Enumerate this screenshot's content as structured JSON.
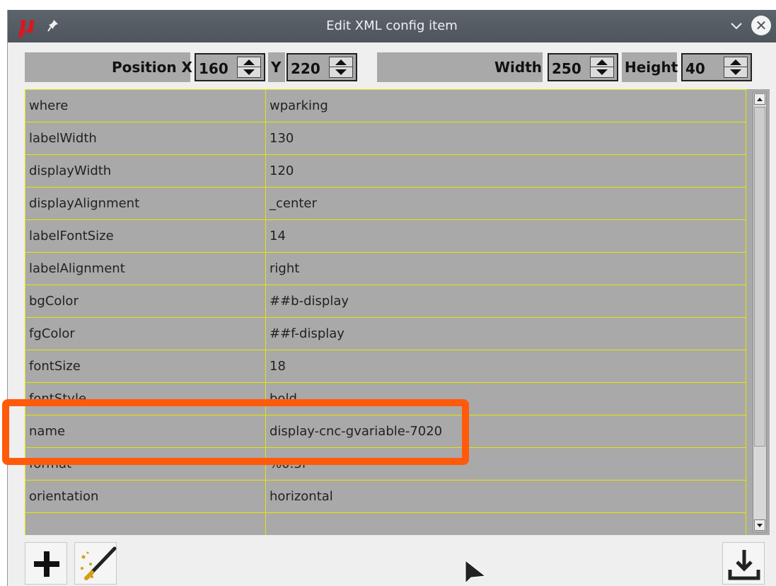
{
  "window": {
    "title": "Edit XML config item",
    "app_logo": "µ"
  },
  "position": {
    "x_label": "Position X",
    "x_value": "160",
    "y_label": "Y",
    "y_value": "220",
    "width_label": "Width",
    "width_value": "250",
    "height_label": "Height",
    "height_value": "40"
  },
  "properties": [
    {
      "key": "where",
      "value": "wparking"
    },
    {
      "key": "labelWidth",
      "value": "130"
    },
    {
      "key": "displayWidth",
      "value": "120"
    },
    {
      "key": "displayAlignment",
      "value": "_center"
    },
    {
      "key": "labelFontSize",
      "value": "14"
    },
    {
      "key": "labelAlignment",
      "value": "right"
    },
    {
      "key": "bgColor",
      "value": "##b-display"
    },
    {
      "key": "fgColor",
      "value": "##f-display"
    },
    {
      "key": "fontSize",
      "value": "18"
    },
    {
      "key": "fontStyle",
      "value": "bold"
    },
    {
      "key": "name",
      "value": "display-cnc-gvariable-7020"
    },
    {
      "key": "format",
      "value": "%0.3f"
    },
    {
      "key": "orientation",
      "value": "horizontal"
    },
    {
      "key": "",
      "value": ""
    }
  ],
  "colors": {
    "highlight": "#ff5a0a",
    "grid_lines": "#e6e600",
    "cell_bg": "#a9a9a9",
    "logo": "#d9171f"
  },
  "icons": [
    "pin-icon",
    "chevron-down-icon",
    "close-icon",
    "plus-icon",
    "magic-wand-icon",
    "download-icon",
    "mouse-cursor-icon"
  ]
}
